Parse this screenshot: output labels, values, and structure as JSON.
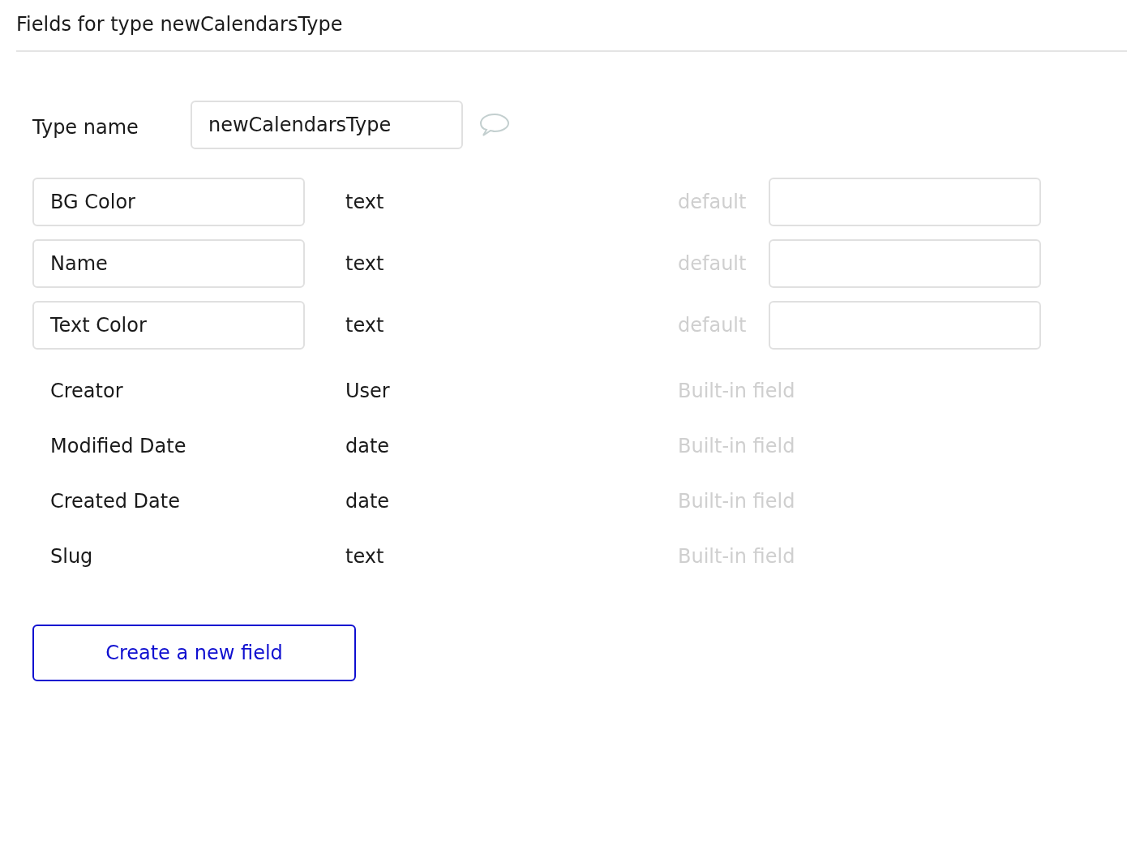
{
  "title": "Fields for type newCalendarsType",
  "type_name": {
    "label": "Type name",
    "value": "newCalendarsType"
  },
  "fields": [
    {
      "kind": "custom",
      "name": "BG Color",
      "type": "text",
      "default_label": "default"
    },
    {
      "kind": "custom",
      "name": "Name",
      "type": "text",
      "default_label": "default"
    },
    {
      "kind": "custom",
      "name": "Text Color",
      "type": "text",
      "default_label": "default"
    },
    {
      "kind": "builtin",
      "name": "Creator",
      "type": "User",
      "note": "Built-in field"
    },
    {
      "kind": "builtin",
      "name": "Modified Date",
      "type": "date",
      "note": "Built-in field"
    },
    {
      "kind": "builtin",
      "name": "Created Date",
      "type": "date",
      "note": "Built-in field"
    },
    {
      "kind": "builtin",
      "name": "Slug",
      "type": "text",
      "note": "Built-in field"
    }
  ],
  "create_button": "Create a new field"
}
